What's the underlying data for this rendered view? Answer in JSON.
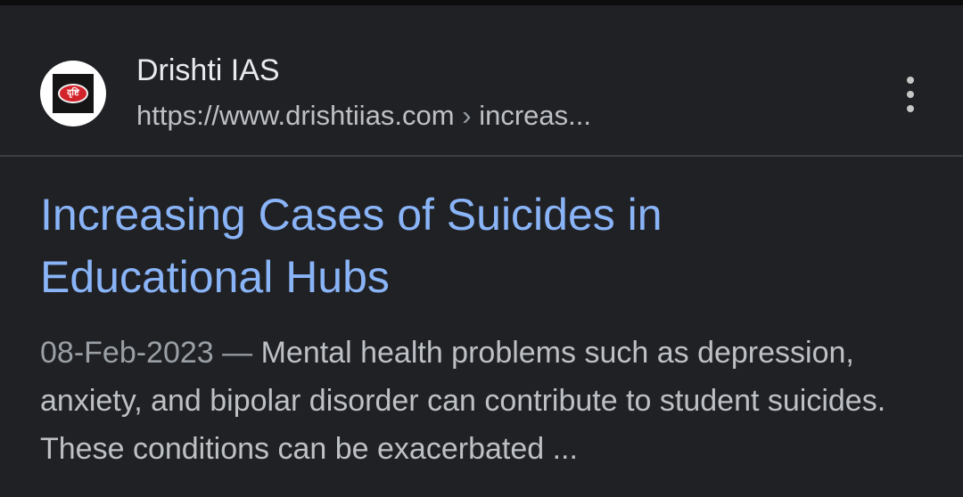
{
  "result": {
    "source": {
      "name": "Drishti IAS",
      "url_host": "https://www.drishtiias.com",
      "url_separator": "›",
      "url_path": "increas...",
      "favicon_text": "दृष्टि",
      "favicon_icon": "drishti-logo-icon"
    },
    "more_icon": "more-vert-icon",
    "title_line1": "Increasing Cases of Suicides in",
    "title_line2": "Educational Hubs",
    "date": "08-Feb-2023",
    "dash": "—",
    "snippet": "Mental health problems such as depression, anxiety, and bipolar disorder can contribute to student suicides. These conditions can be exacerbated ..."
  },
  "colors": {
    "background": "#202124",
    "title_link": "#8ab4f8",
    "primary_text": "#e8eaed",
    "secondary_text": "#bdc1c6",
    "divider": "#3c4043"
  }
}
